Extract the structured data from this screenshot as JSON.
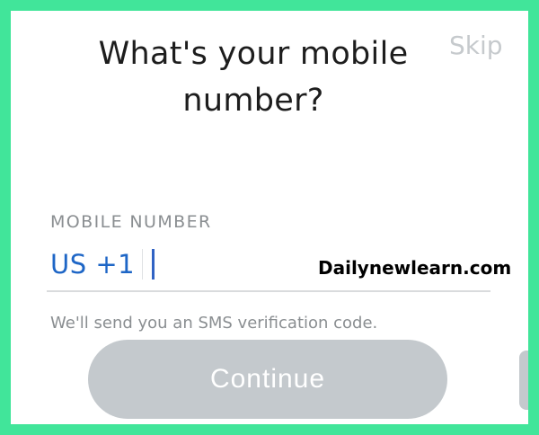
{
  "header": {
    "title": "What's your mobile number?",
    "skip_label": "Skip"
  },
  "phone": {
    "field_label": "MOBILE NUMBER",
    "country_code": "US +1",
    "number_value": ""
  },
  "watermark": "Dailynewlearn.com",
  "helper_text": "We'll send you an SMS verification code.",
  "continue_label": "Continue",
  "colors": {
    "background_border": "#41e59a",
    "accent_blue": "#1e66c6",
    "button_disabled": "#c4c9cd",
    "muted_text": "#8a8e91"
  }
}
